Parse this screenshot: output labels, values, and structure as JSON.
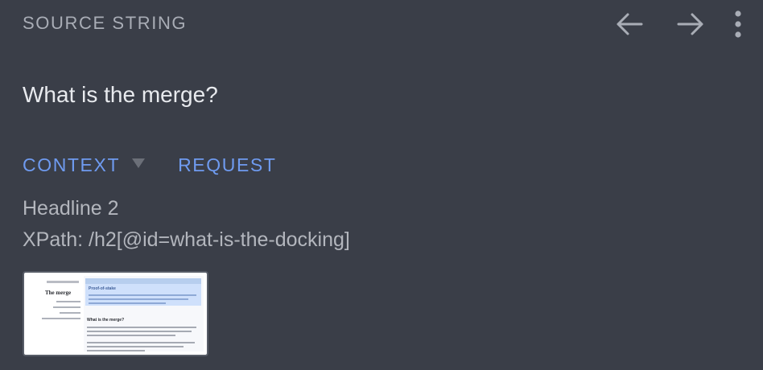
{
  "header": {
    "section_label": "SOURCE STRING",
    "icons": {
      "prev": "arrow-left-icon",
      "next": "arrow-right-icon",
      "more": "more-vertical-icon"
    }
  },
  "source": {
    "text": "What is the merge?"
  },
  "tabs": [
    {
      "label": "CONTEXT"
    },
    {
      "label": "REQUEST"
    }
  ],
  "context": {
    "element_type": "Headline 2",
    "xpath": "XPath: /h2[@id=what-is-the-docking]",
    "screenshot_thumb": {
      "page_title": "The merge",
      "hero_heading": "Proof-of-stake",
      "section_heading": "What is the merge?"
    }
  },
  "colors": {
    "background": "#3a3e48",
    "accent": "#6f9bf0",
    "label": "#a9adb6",
    "primary_text": "#e8eaee",
    "secondary_text": "#b3b6bd"
  }
}
